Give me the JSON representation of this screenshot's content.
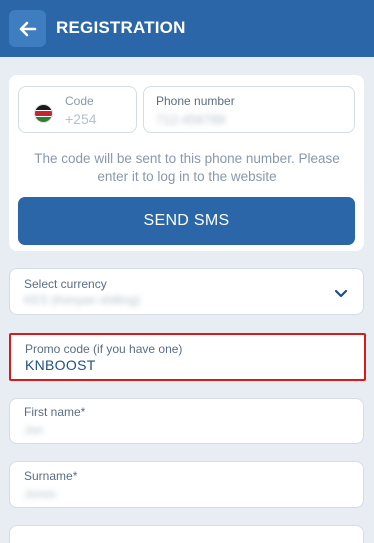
{
  "header": {
    "title": "REGISTRATION",
    "back_icon": "arrow-left-icon"
  },
  "phone": {
    "code_label": "Code",
    "code_value": "+254",
    "number_label": "Phone number",
    "number_value": "712-456789",
    "flag_icon": "kenya-flag-icon"
  },
  "note": "The code will be sent to this phone number. Please enter it to log in to the website",
  "send_sms": "SEND SMS",
  "currency": {
    "label": "Select currency",
    "value": "KES (Kenyan shilling)",
    "icon": "chevron-down-icon"
  },
  "promo": {
    "label": "Promo code (if you have one)",
    "value": "KNBOOST"
  },
  "first_name": {
    "label": "First name*",
    "value": "Jon"
  },
  "surname": {
    "label": "Surname*",
    "value": "Jones"
  },
  "colors": {
    "primary": "#2a66a8",
    "highlight": "#d61b1b",
    "background": "#e8edf3"
  }
}
